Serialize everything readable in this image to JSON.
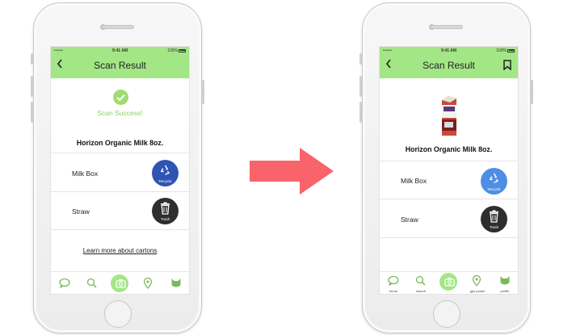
{
  "colors": {
    "header_green": "#a3e685",
    "success_green": "#8bd15f",
    "recycle_blue_dark": "#2f54b3",
    "recycle_blue_light": "#4e8fe3",
    "trash_dark": "#2e2e2e",
    "arrow_red": "#f8646a"
  },
  "status": {
    "time": "9:41 AM",
    "battery": "100%",
    "signal": "•••••"
  },
  "left_screen": {
    "title": "Scan Result",
    "success_text": "Scan Success!",
    "product_name": "Horizon Organic Milk 8oz.",
    "items": [
      {
        "label": "Milk Box",
        "action_label": "Recycle",
        "icon": "recycle-icon"
      },
      {
        "label": "Straw",
        "action_label": "Trash",
        "icon": "trash-icon"
      }
    ],
    "learn_more": "Learn more about cartons",
    "tabs": [
      {
        "icon": "forum-icon"
      },
      {
        "icon": "search-icon"
      },
      {
        "icon": "camera-icon",
        "active": true
      },
      {
        "icon": "location-pin-icon"
      },
      {
        "icon": "cat-profile-icon"
      }
    ]
  },
  "right_screen": {
    "title": "Scan Result",
    "product_name": "Horizon Organic Milk 8oz.",
    "items": [
      {
        "label": "Milk Box",
        "action_label": "Recycle",
        "icon": "recycle-icon"
      },
      {
        "label": "Straw",
        "action_label": "Trash",
        "icon": "trash-icon"
      }
    ],
    "tabs": [
      {
        "icon": "forum-icon",
        "label": "forum"
      },
      {
        "icon": "search-icon",
        "label": "search"
      },
      {
        "icon": "camera-icon",
        "label": "",
        "active": true
      },
      {
        "icon": "location-pin-icon",
        "label": "gps poster"
      },
      {
        "icon": "cat-profile-icon",
        "label": "profile"
      }
    ]
  }
}
